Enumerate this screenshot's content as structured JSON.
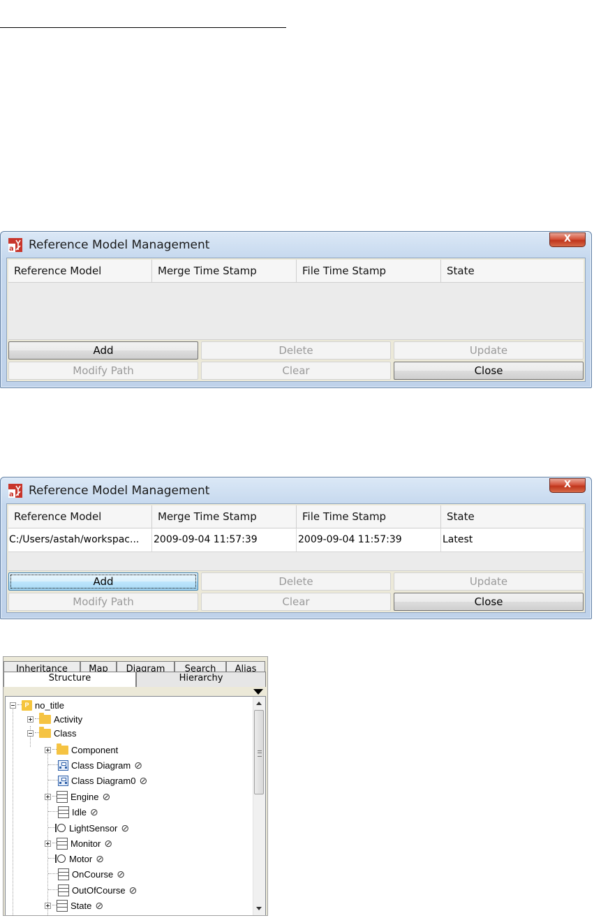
{
  "dialog_before": {
    "title": "Reference Model Management",
    "close_label": "X",
    "columns": [
      "Reference Model",
      "Merge Time Stamp",
      "File Time Stamp",
      "State"
    ],
    "rows": [],
    "buttons": {
      "add": "Add",
      "delete": "Delete",
      "update": "Update",
      "modify_path": "Modify Path",
      "clear": "Clear",
      "close": "Close"
    }
  },
  "dialog_after": {
    "title": "Reference Model Management",
    "close_label": "X",
    "columns": [
      "Reference Model",
      "Merge Time Stamp",
      "File Time Stamp",
      "State"
    ],
    "rows": [
      [
        "C:/Users/astah/workspac...",
        "2009-09-04 11:57:39",
        "2009-09-04 11:57:39",
        "Latest"
      ]
    ],
    "buttons": {
      "add": "Add",
      "delete": "Delete",
      "update": "Update",
      "modify_path": "Modify Path",
      "clear": "Clear",
      "close": "Close"
    }
  },
  "tree_panel": {
    "back_tabs": [
      "Inheritance",
      "Map",
      "Diagram",
      "Search",
      "Alias"
    ],
    "front_tabs": [
      "Structure",
      "Hierarchy"
    ],
    "active_tab": "Structure",
    "project_icon_letter": "P",
    "nodes": [
      {
        "label": "no_title",
        "icon": "project-icon"
      },
      {
        "label": "Activity",
        "icon": "folder-icon"
      },
      {
        "label": "Class",
        "icon": "folder-icon"
      },
      {
        "label": "Component",
        "icon": "folder-icon"
      },
      {
        "label": "Class Diagram",
        "icon": "class-diagram-icon"
      },
      {
        "label": "Class Diagram0",
        "icon": "class-diagram-icon"
      },
      {
        "label": "Engine",
        "icon": "class-icon"
      },
      {
        "label": "Idle",
        "icon": "class-icon"
      },
      {
        "label": "LightSensor",
        "icon": "interface-icon"
      },
      {
        "label": "Monitor",
        "icon": "class-icon"
      },
      {
        "label": "Motor",
        "icon": "interface-icon"
      },
      {
        "label": "OnCourse",
        "icon": "class-icon"
      },
      {
        "label": "OutOfCourse",
        "icon": "class-icon"
      },
      {
        "label": "State",
        "icon": "class-icon"
      }
    ],
    "reference_marker": "⊘"
  }
}
